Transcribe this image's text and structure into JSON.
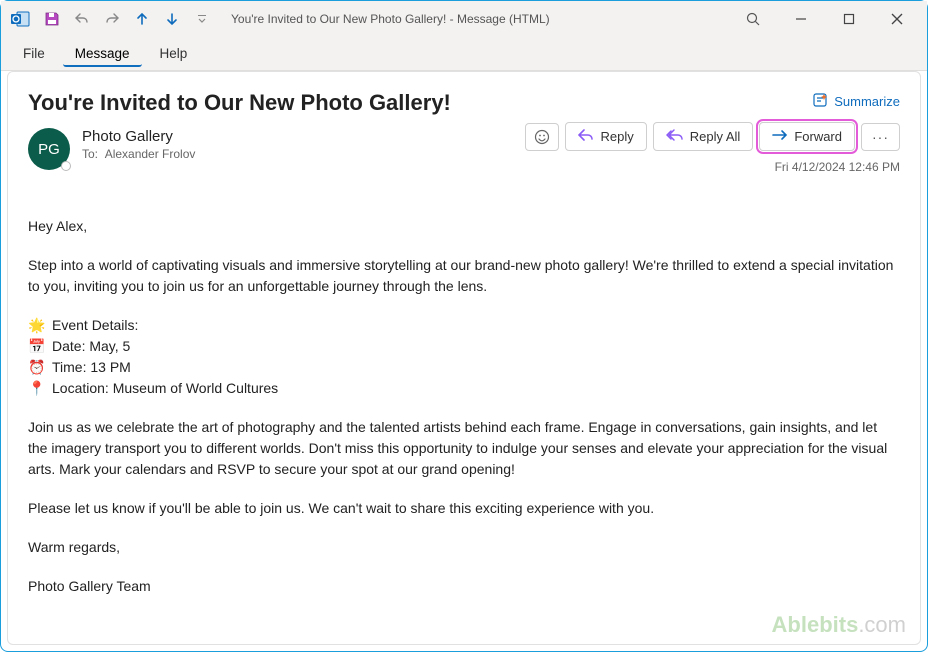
{
  "window": {
    "title": "You're Invited to Our New Photo Gallery!  -  Message (HTML)"
  },
  "menubar": {
    "file": "File",
    "message": "Message",
    "help": "Help"
  },
  "header": {
    "subject": "You're Invited to Our New Photo Gallery!",
    "summarize_label": "Summarize",
    "avatar_initials": "PG",
    "from_name": "Photo Gallery",
    "to_label": "To:",
    "to_value": "Alexander Frolov",
    "timestamp": "Fri 4/12/2024 12:46 PM",
    "actions": {
      "reply": "Reply",
      "reply_all": "Reply All",
      "forward": "Forward"
    }
  },
  "body": {
    "greeting": "Hey Alex,",
    "intro": "Step into a world of captivating visuals and immersive storytelling at our brand-new photo gallery! We're thrilled to extend a special invitation to you, inviting you to join us for an unforgettable journey through the lens.",
    "details_title": "Event Details:",
    "details": {
      "date_label": "Date: May, 5",
      "time_label": "Time: 13 PM",
      "location_label": "Location: Museum of World Cultures"
    },
    "para2": "Join us as we celebrate the art of photography and the talented artists behind each frame. Engage in conversations, gain insights, and let the imagery transport you to different worlds. Don't miss this opportunity to indulge your senses and elevate your appreciation for the visual arts. Mark your calendars and RSVP to secure your spot at our grand opening!",
    "para3": "Please let us know if you'll be able to join us. We can't wait to share this exciting experience with you.",
    "closing": "Warm regards,",
    "signature": "Photo Gallery Team"
  },
  "watermark": {
    "brand": "Ablebits",
    "suffix": ".com"
  },
  "icons": {
    "sparkle": "🌟",
    "calendar": "📅",
    "clock": "⏰",
    "pin": "📍"
  }
}
